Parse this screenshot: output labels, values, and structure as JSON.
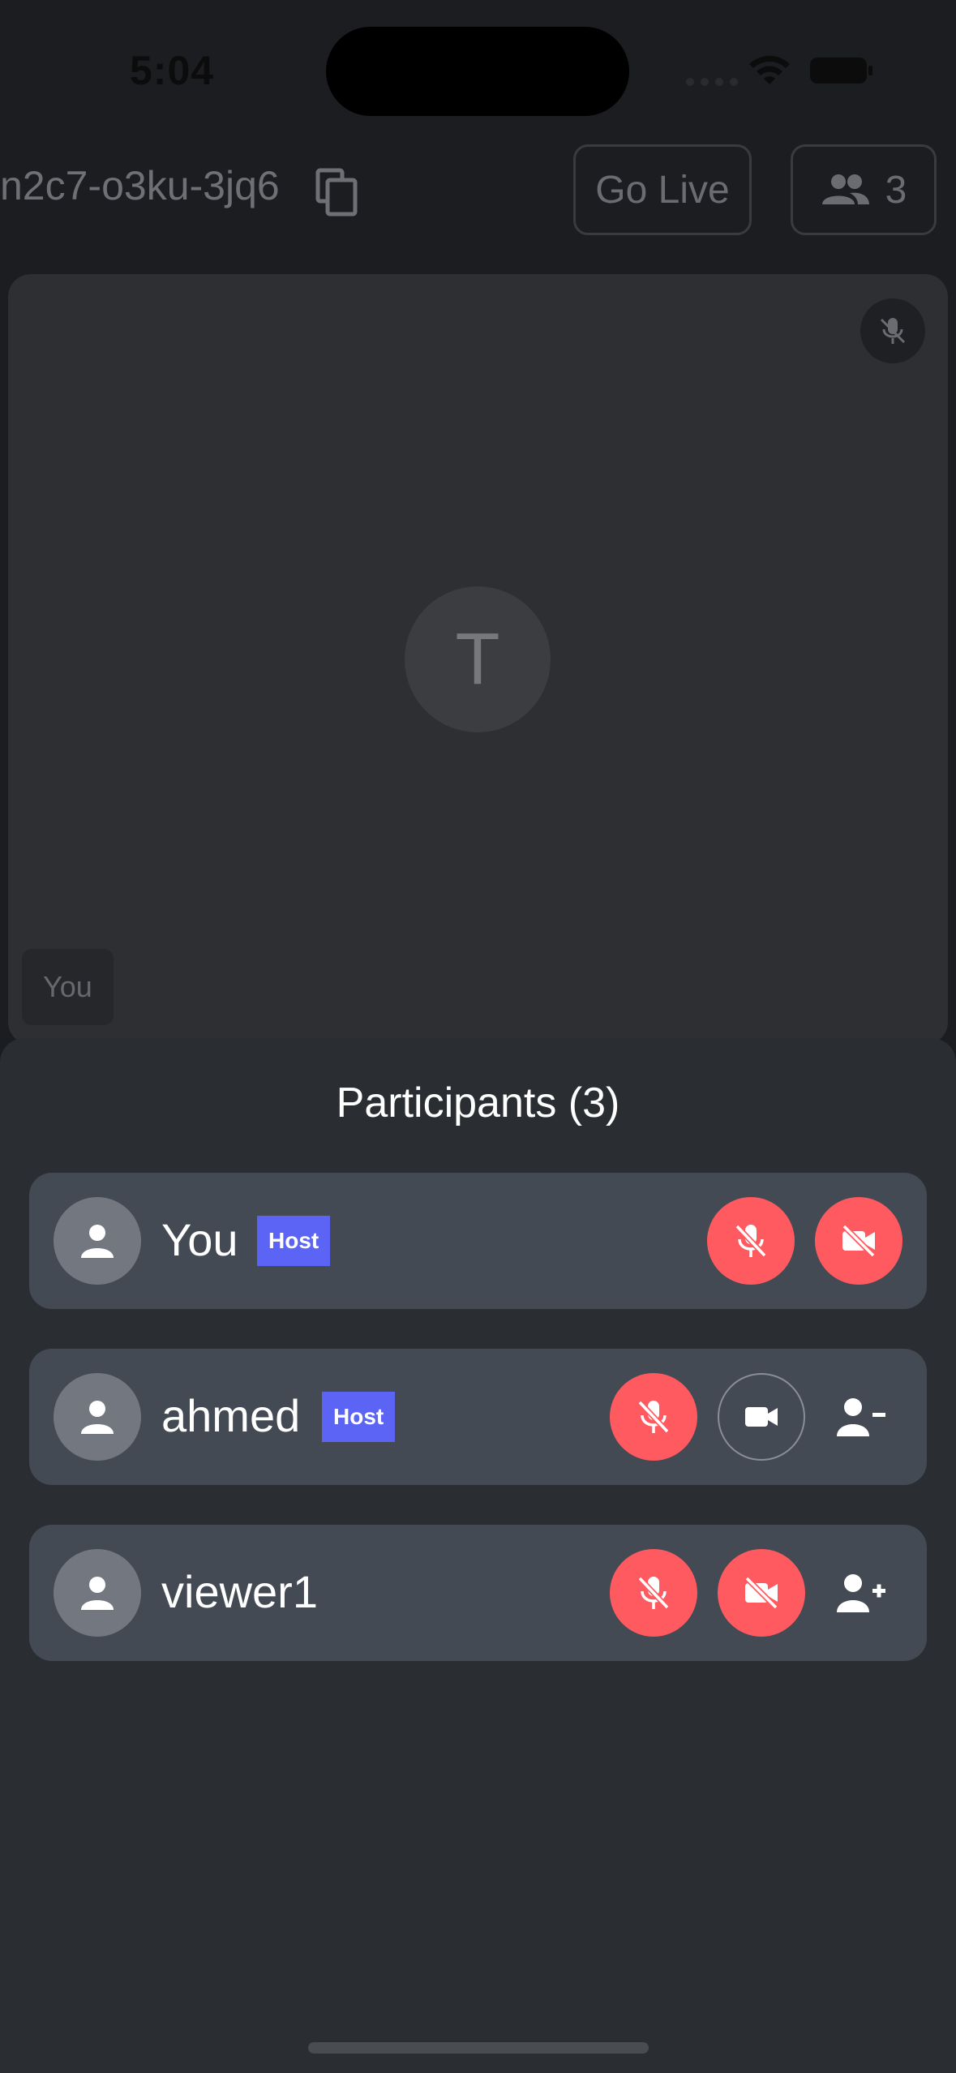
{
  "status_bar": {
    "time": "5:04"
  },
  "top_bar": {
    "room_code": "n2c7-o3ku-3jq6",
    "go_live_label": "Go Live",
    "participant_count": "3"
  },
  "video_tile": {
    "avatar_initial": "T",
    "name_label": "You"
  },
  "participants_panel": {
    "title": "Participants (3)",
    "host_badge": "Host",
    "participants": [
      {
        "name": "You",
        "is_host": true,
        "mic": "muted",
        "camera": "off"
      },
      {
        "name": "ahmed",
        "is_host": true,
        "mic": "muted",
        "camera": "on",
        "action": "remove-user"
      },
      {
        "name": "viewer1",
        "is_host": false,
        "mic": "muted",
        "camera": "off",
        "action": "add-user"
      }
    ]
  },
  "colors": {
    "danger": "#ff5a5f",
    "host_badge": "#5b64f5",
    "row_background": "#434a53",
    "sheet_background": "#2a2d31"
  },
  "icons": {
    "copy": "copy-icon",
    "people": "people-icon",
    "mic_off": "mic-off-icon",
    "video_off": "video-off-icon",
    "video_on": "video-icon",
    "person": "person-icon",
    "person_remove": "person-remove-icon",
    "person_add": "person-add-icon"
  }
}
